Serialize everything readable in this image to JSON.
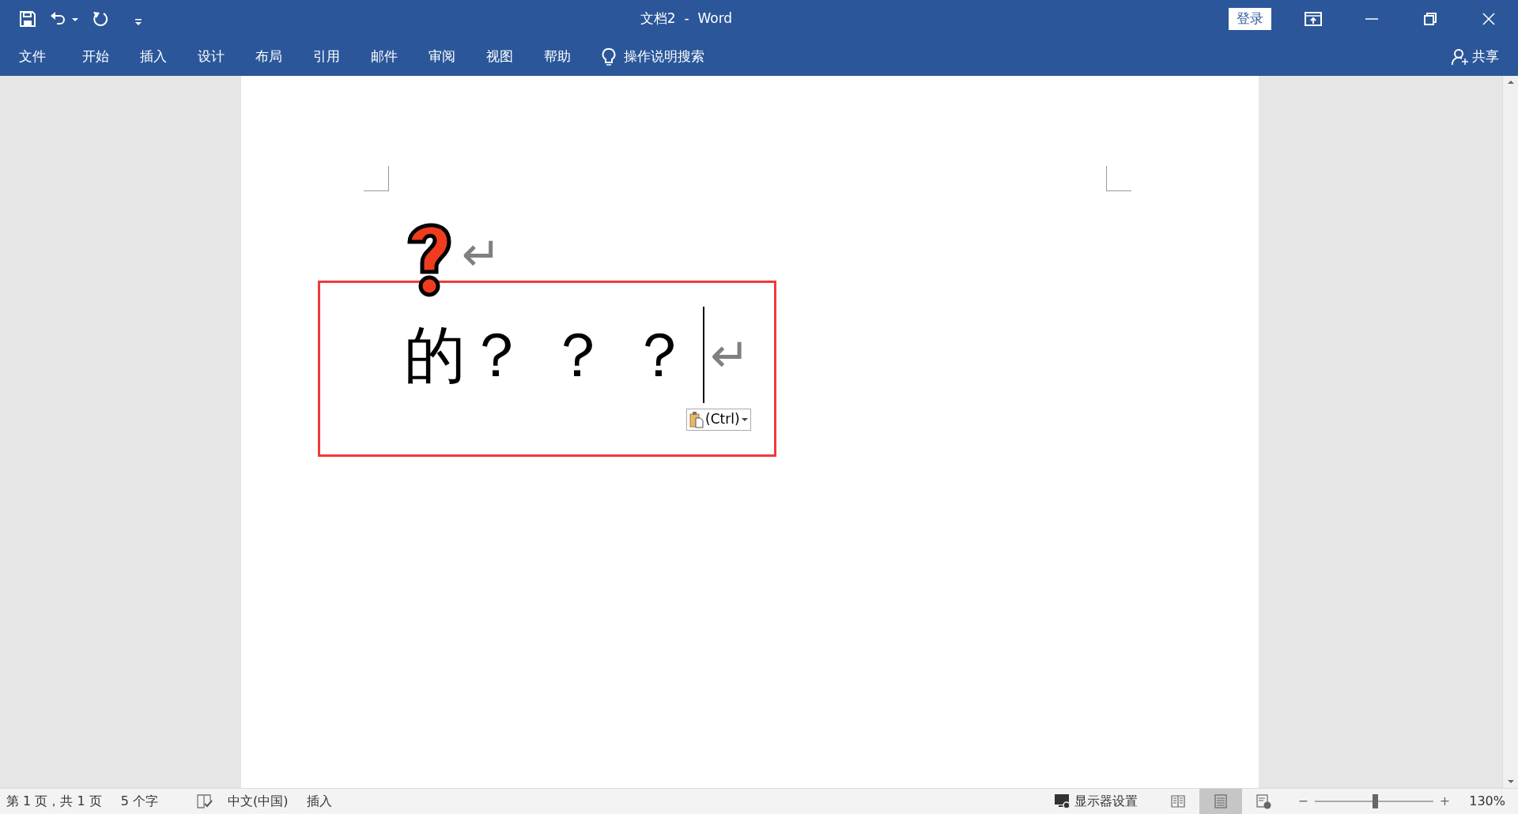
{
  "window": {
    "title": "文档2  -  Word",
    "sign_in": "登录"
  },
  "ribbon": {
    "tabs": [
      {
        "label": "文件",
        "selected": false
      },
      {
        "label": "开始",
        "selected": false
      },
      {
        "label": "插入",
        "selected": false
      },
      {
        "label": "设计",
        "selected": false
      },
      {
        "label": "布局",
        "selected": false
      },
      {
        "label": "引用",
        "selected": false
      },
      {
        "label": "邮件",
        "selected": false
      },
      {
        "label": "审阅",
        "selected": false
      },
      {
        "label": "视图",
        "selected": false
      },
      {
        "label": "帮助",
        "selected": false
      }
    ],
    "tell_me": "操作说明搜索",
    "share": "共享"
  },
  "document": {
    "paragraphs": [
      {
        "kind": "picture",
        "mark": "↵"
      },
      {
        "kind": "text",
        "text": "的？ ？ ？",
        "mark": "↵",
        "paste_options": "(Ctrl)"
      }
    ]
  },
  "status_bar": {
    "page": "第 1 页，共 1 页",
    "words": "5 个字",
    "language": "中文(中国)",
    "mode": "插入",
    "display_settings": "显示器设置",
    "views": [
      {
        "kind": "read",
        "selected": false
      },
      {
        "kind": "print",
        "selected": true
      },
      {
        "kind": "web",
        "selected": false
      }
    ],
    "zoom": {
      "out": "−",
      "in": "+",
      "level": 0.51,
      "reading": "130%"
    }
  }
}
